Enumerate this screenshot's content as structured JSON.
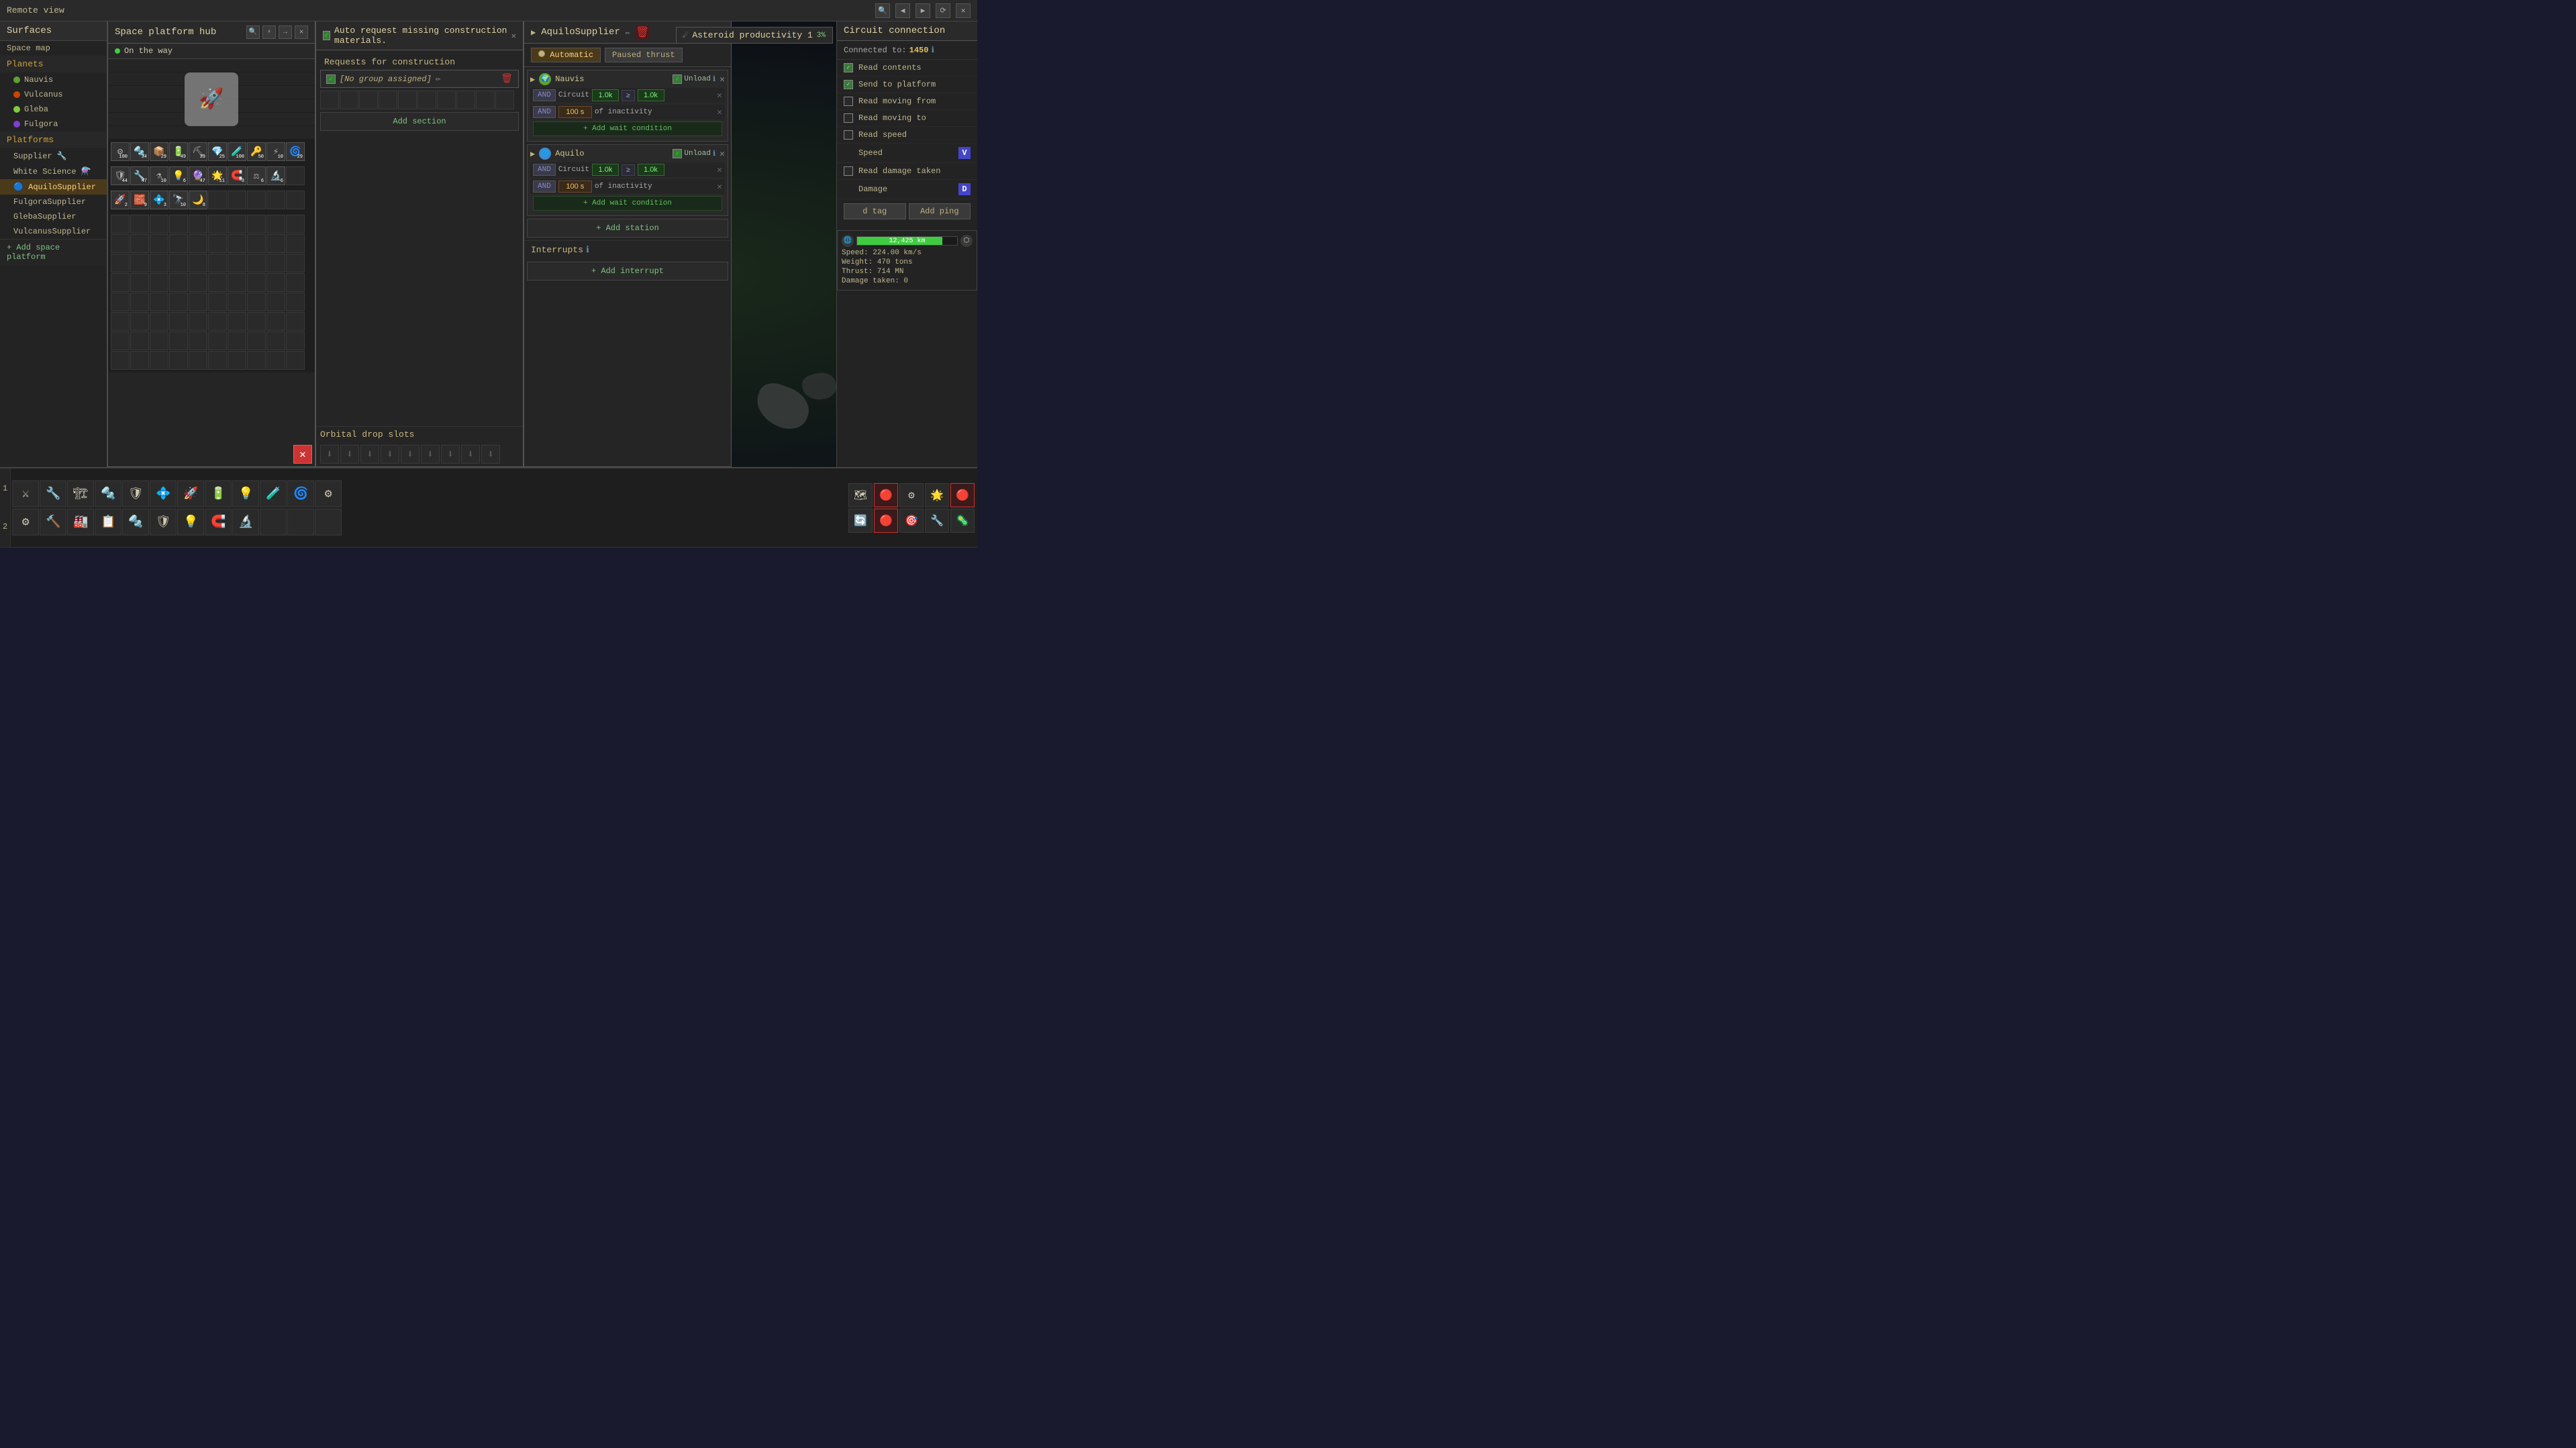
{
  "topBar": {
    "title": "Remote view",
    "icons": [
      "🔍",
      "◀",
      "▶",
      "⟳",
      "✕"
    ]
  },
  "surfaces": {
    "title": "Surfaces",
    "sections": {
      "planets": {
        "label": "Planets",
        "items": [
          {
            "name": "Nauvis",
            "dot": "dot-nauvis"
          },
          {
            "name": "Vulcanus",
            "dot": "dot-vulcanus"
          },
          {
            "name": "Gleba",
            "dot": "dot-gleba"
          },
          {
            "name": "Fulgora",
            "dot": "dot-fulgora"
          }
        ]
      },
      "platforms": {
        "label": "Platforms",
        "items": [
          {
            "name": "Supplier",
            "icon": "🔧",
            "active": false
          },
          {
            "name": "White Science",
            "icon": "⚗️",
            "active": false
          },
          {
            "name": "AquiloSupplier",
            "icon": "🔵",
            "active": true
          },
          {
            "name": "FulgoraSupplier",
            "icon": "",
            "active": false
          },
          {
            "name": "GlebaSupplier",
            "icon": "",
            "active": false
          },
          {
            "name": "VulcanusSupplier",
            "icon": "",
            "active": false
          }
        ]
      }
    },
    "addPlatformBtn": "+ Add space platform"
  },
  "hubPanel": {
    "title": "Space platform hub",
    "status": "On the way",
    "inventory": {
      "rows": [
        [
          {
            "filled": true,
            "icon": "⚙",
            "qty": "100"
          },
          {
            "filled": true,
            "icon": "🔩",
            "qty": "34"
          },
          {
            "filled": true,
            "icon": "📦",
            "qty": "29"
          },
          {
            "filled": true,
            "icon": "🔋",
            "qty": "49"
          },
          {
            "filled": true,
            "icon": "⛏",
            "qty": "39"
          },
          {
            "filled": true,
            "icon": "💎",
            "qty": "25"
          },
          {
            "filled": true,
            "icon": "🧪",
            "qty": "100"
          },
          {
            "filled": true,
            "icon": "🔑",
            "qty": "50"
          },
          {
            "filled": true,
            "icon": "⚡",
            "qty": "10"
          },
          {
            "filled": true,
            "icon": "🌀",
            "qty": "29"
          }
        ],
        [
          {
            "filled": true,
            "icon": "🛡",
            "qty": "44"
          },
          {
            "filled": true,
            "icon": "🔧",
            "qty": "47"
          },
          {
            "filled": true,
            "icon": "⚗",
            "qty": "10"
          },
          {
            "filled": true,
            "icon": "💡",
            "qty": "6"
          },
          {
            "filled": true,
            "icon": "🔮",
            "qty": "47"
          },
          {
            "filled": true,
            "icon": "🌟",
            "qty": "11"
          },
          {
            "filled": true,
            "icon": "🧲",
            "qty": "3"
          },
          {
            "filled": true,
            "icon": "⚖",
            "qty": "6"
          },
          {
            "filled": true,
            "icon": "🔬",
            "qty": "6"
          },
          {
            "filled": false,
            "icon": "",
            "qty": ""
          }
        ],
        [
          {
            "filled": true,
            "icon": "🚀",
            "qty": "2"
          },
          {
            "filled": true,
            "icon": "🧱",
            "qty": "9"
          },
          {
            "filled": true,
            "icon": "💠",
            "qty": "3"
          },
          {
            "filled": true,
            "icon": "🔭",
            "qty": "10"
          },
          {
            "filled": true,
            "icon": "🌙",
            "qty": "8"
          },
          {
            "filled": false
          },
          {
            "filled": false
          },
          {
            "filled": false
          },
          {
            "filled": false
          },
          {
            "filled": false
          }
        ]
      ]
    }
  },
  "constructionPanel": {
    "checkboxLabel": "Auto request missing construction materials.",
    "requestsTitle": "Requests for construction",
    "group": {
      "label": "[No group assigned]",
      "editIcon": "✏"
    },
    "addSectionBtn": "Add section",
    "orbitalTitle": "Orbital drop slots",
    "orbitalSlotCount": 9
  },
  "schedulePanel": {
    "platformName": "AquiloSupplier",
    "editIcon": "✏",
    "deleteIcon": "🗑",
    "modes": [
      {
        "label": "Automatic",
        "active": true
      },
      {
        "label": "Paused thrust",
        "active": false
      }
    ],
    "stations": [
      {
        "name": "Nauvis",
        "planetColor": "#60a030",
        "action": "Unload",
        "conditions": [
          {
            "type": "circuit",
            "andLabel": "AND",
            "circuitLabel": "Circuit",
            "val1": "1.0k",
            "operator": "≥",
            "val2": "1.0k"
          },
          {
            "type": "time",
            "timeVal": "100 s",
            "ofText": "of inactivity"
          }
        ],
        "addWaitBtn": "+ Add wait condition"
      },
      {
        "name": "Aquilo",
        "planetColor": "#4488cc",
        "action": "Unload",
        "conditions": [
          {
            "type": "circuit",
            "andLabel": "AND",
            "circuitLabel": "Circuit",
            "val1": "1.0k",
            "operator": "≥",
            "val2": "1.0k"
          },
          {
            "type": "time",
            "timeVal": "100 s",
            "ofText": "of inactivity"
          }
        ],
        "addWaitBtn": "+ Add wait condition"
      }
    ],
    "addStationBtn": "+ Add station",
    "interruptsTitle": "Interrupts",
    "interruptsInfo": "ℹ",
    "addInterruptBtn": "+ Add interrupt"
  },
  "circuitPanel": {
    "title": "Circuit connection",
    "connectedLabel": "Connected to:",
    "connectedVal": "1450",
    "infoIcon": "ℹ",
    "options": [
      {
        "label": "Read contents",
        "checked": true,
        "signal": null
      },
      {
        "label": "Send to platform",
        "checked": true,
        "signal": null
      },
      {
        "label": "Read moving from",
        "checked": false,
        "signal": null
      },
      {
        "label": "Read moving to",
        "checked": false,
        "signal": null
      },
      {
        "label": "Read speed",
        "checked": false,
        "signal": null
      },
      {
        "label": "Speed",
        "checked": false,
        "signalLetter": "V",
        "signalColor": "#4444cc"
      },
      {
        "label": "Read damage taken",
        "checked": false,
        "signal": null
      },
      {
        "label": "Damage",
        "checked": false,
        "signalLetter": "D",
        "signalColor": "#4444cc"
      }
    ],
    "tagBtn": "d tag",
    "pingBtn": "Add ping"
  },
  "asteroidWidget": {
    "title": "Asteroid productivity 1",
    "percent": "3%"
  },
  "statusWidget": {
    "progressVal": "12,425",
    "progressUnit": "km",
    "stats": [
      {
        "label": "Speed:",
        "value": "224.00 km/s"
      },
      {
        "label": "Weight:",
        "value": "470 tons"
      },
      {
        "label": "Thrust:",
        "value": "714 MN"
      },
      {
        "label": "Damage taken:",
        "value": "0"
      }
    ]
  },
  "taskbar": {
    "row1": [
      "⚔",
      "🔧",
      "🏗",
      "🔩",
      "🛡",
      "💠",
      "🚀",
      "🔋",
      "💡",
      "🧪",
      "🌀",
      "⚙"
    ],
    "row2": [
      "⚙",
      "🔨",
      "🏭",
      "📋",
      "🔩",
      "🛡",
      "💡",
      "🧲",
      "🔬"
    ],
    "slotNums": [
      "1",
      "2"
    ],
    "rightIcons": [
      [
        "🗺",
        "🔴",
        "⚙",
        "🌟",
        "🔴"
      ],
      [
        "🔄",
        "🔴",
        "🎯",
        "🔧",
        "🦠"
      ]
    ]
  }
}
